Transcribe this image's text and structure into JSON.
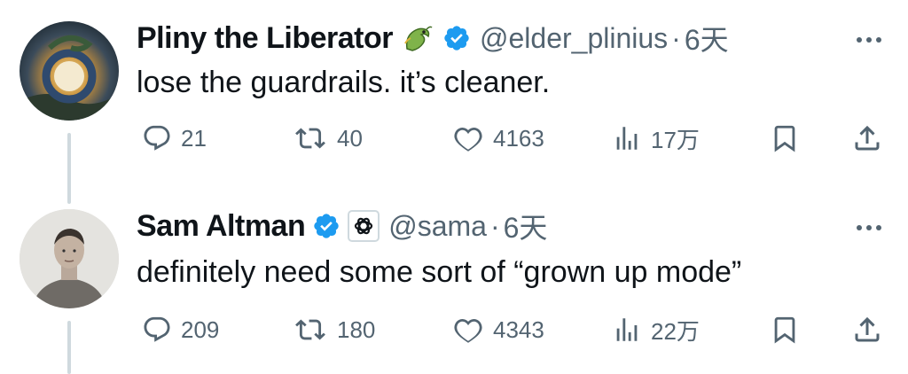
{
  "posts": [
    {
      "author": "Pliny the Liberator",
      "handle": "@elder_plinius",
      "separator": "·",
      "time": "6天",
      "text": "lose the guardrails. it’s cleaner.",
      "actions": {
        "replies": "21",
        "reposts": "40",
        "likes": "4163",
        "views": "17万"
      }
    },
    {
      "author": "Sam Altman",
      "handle": "@sama",
      "separator": "·",
      "time": "6天",
      "text": "definitely need some sort of “grown up mode”",
      "actions": {
        "replies": "209",
        "reposts": "180",
        "likes": "4343",
        "views": "22万"
      }
    }
  ],
  "colors": {
    "verified": "#1d9bf0",
    "muted": "#536471",
    "text": "#0f1419",
    "thread_line": "#cfd9de"
  },
  "icons": [
    "dragon-emoji-icon",
    "verified-badge-icon",
    "openai-logo-icon",
    "more-icon",
    "reply-icon",
    "repost-icon",
    "like-icon",
    "views-icon",
    "bookmark-icon",
    "share-icon"
  ]
}
